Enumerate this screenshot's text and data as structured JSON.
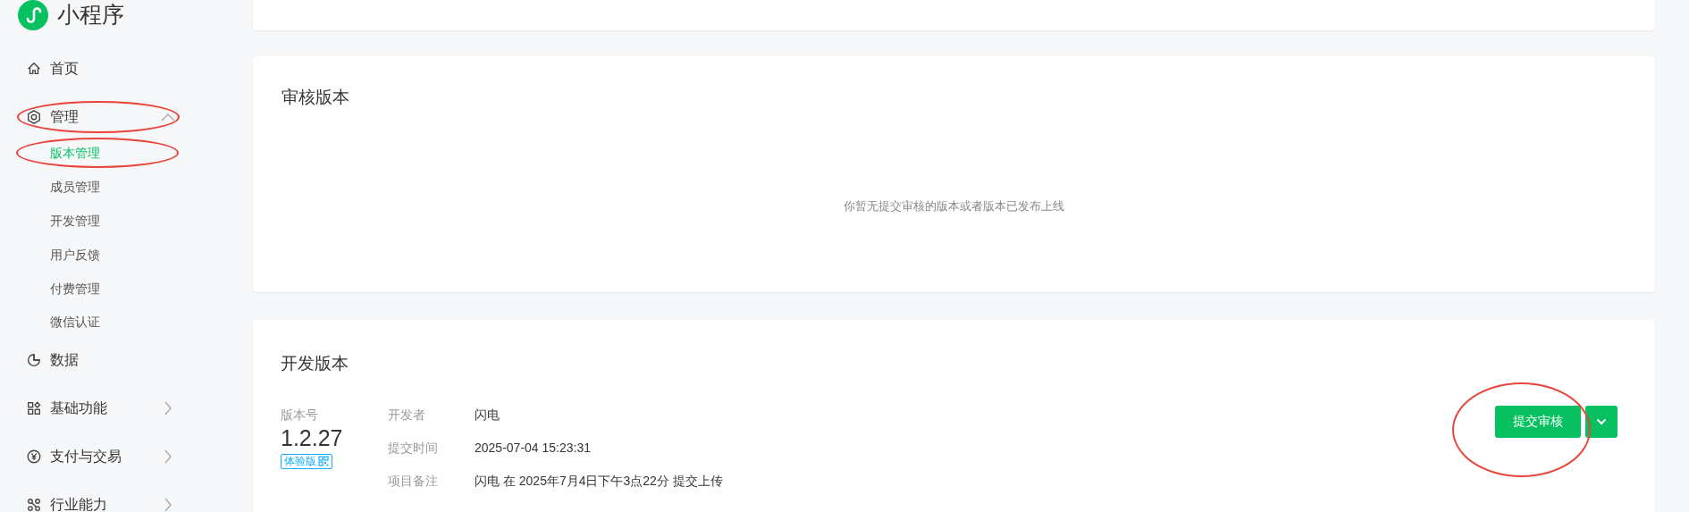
{
  "app": {
    "title": "小程序"
  },
  "sidebar": {
    "items": [
      {
        "label": "首页",
        "kind": "link"
      },
      {
        "label": "管理",
        "kind": "group",
        "expanded": true,
        "circled": true,
        "children": [
          {
            "label": "版本管理",
            "selected": true,
            "circled": true
          },
          {
            "label": "成员管理",
            "selected": false,
            "circled": false
          },
          {
            "label": "开发管理",
            "selected": false,
            "circled": false
          },
          {
            "label": "用户反馈",
            "selected": false,
            "circled": false
          },
          {
            "label": "付费管理",
            "selected": false,
            "circled": false
          },
          {
            "label": "微信认证",
            "selected": false,
            "circled": false
          }
        ]
      },
      {
        "label": "数据",
        "kind": "link"
      },
      {
        "label": "基础功能",
        "kind": "group",
        "expanded": false,
        "circled": false
      },
      {
        "label": "支付与交易",
        "kind": "group",
        "expanded": false,
        "circled": false
      },
      {
        "label": "行业能力",
        "kind": "group",
        "expanded": false,
        "circled": false
      }
    ]
  },
  "review_version": {
    "title": "审核版本",
    "empty_text": "你暂无提交审核的版本或者版本已发布上线"
  },
  "dev_version": {
    "title": "开发版本",
    "version_label": "版本号",
    "version": "1.2.27",
    "badge": "体验版",
    "fields": [
      {
        "label": "开发者",
        "value": "闪电"
      },
      {
        "label": "提交时间",
        "value": "2025-07-04 15:23:31"
      },
      {
        "label": "项目备注",
        "value": "闪电 在 2025年7月4日下午3点22分 提交上传"
      }
    ],
    "submit_button": {
      "label": "提交审核",
      "circled": true
    }
  }
}
